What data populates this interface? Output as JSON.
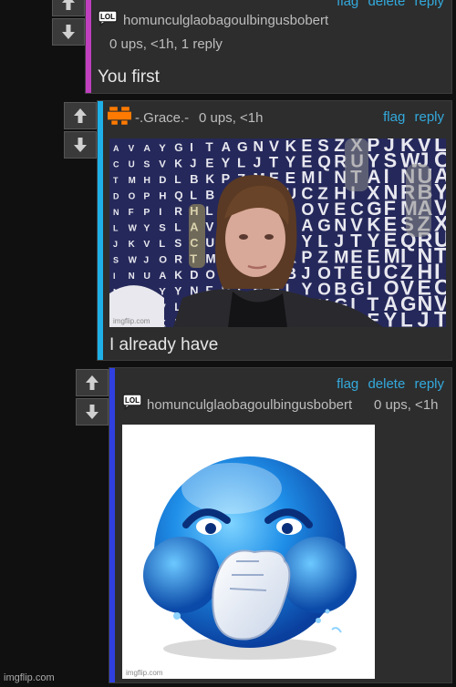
{
  "comments": [
    {
      "username": "homunculglaobagoulbingusbobert",
      "stats": "0 ups, <1h, 1 reply",
      "text": "You first",
      "actions": [
        "flag",
        "delete",
        "reply"
      ],
      "bar_color": "#c040c0"
    },
    {
      "username": "-.Grace.-",
      "stats": "0 ups, <1h",
      "text": "I already have",
      "actions": [
        "flag",
        "reply"
      ],
      "bar_color": "#1fb0e8",
      "image_watermark": "imgflip.com"
    },
    {
      "username": "homunculglaobagoulbingusbobert",
      "stats": "0 ups, <1h",
      "actions": [
        "flag",
        "delete",
        "reply"
      ],
      "bar_color": "#3040e0",
      "image_watermark": "imgflip.com"
    }
  ],
  "icons": {
    "upvote": "up-arrow-icon",
    "downvote": "down-arrow-icon",
    "avatar_lol": "lol-speech-bubble-icon",
    "avatar_grace": "orange-pixel-avatar-icon"
  },
  "wordsearch_letters": [
    "A",
    "V",
    "A",
    "Y",
    "G",
    "I",
    "T",
    "A",
    "G",
    "N",
    "V",
    "K",
    "E",
    "S",
    "Z",
    "X",
    "P",
    "J",
    "K",
    "V",
    "L",
    "S",
    "C",
    "U",
    "S",
    "V",
    "K",
    "J",
    "E",
    "Y",
    "L",
    "J",
    "T",
    "Y",
    "E",
    "Q",
    "R",
    "U",
    "Y",
    "S",
    "W",
    "J",
    "O",
    "R",
    "T",
    "M",
    "H",
    "D",
    "L",
    "B",
    "K",
    "P",
    "Z",
    "M",
    "E",
    "E",
    "M",
    "I",
    "N",
    "T",
    "A",
    "I",
    "N",
    "U",
    "A",
    "K",
    "D",
    "O",
    "P",
    "H",
    "Q",
    "L",
    "B",
    "J",
    "O",
    "T",
    "E",
    "U",
    "C",
    "Z",
    "H",
    "I",
    "X",
    "N",
    "R",
    "B",
    "Y",
    "Y",
    "N",
    "F",
    "P",
    "I",
    "R",
    "H",
    "L",
    "Y",
    "O",
    "B",
    "G",
    "I",
    "O",
    "V",
    "E",
    "C",
    "G",
    "F",
    "M",
    "A",
    "V",
    "L",
    "L",
    "W",
    "Y",
    "S",
    "L"
  ],
  "footer": "imgflip.com"
}
